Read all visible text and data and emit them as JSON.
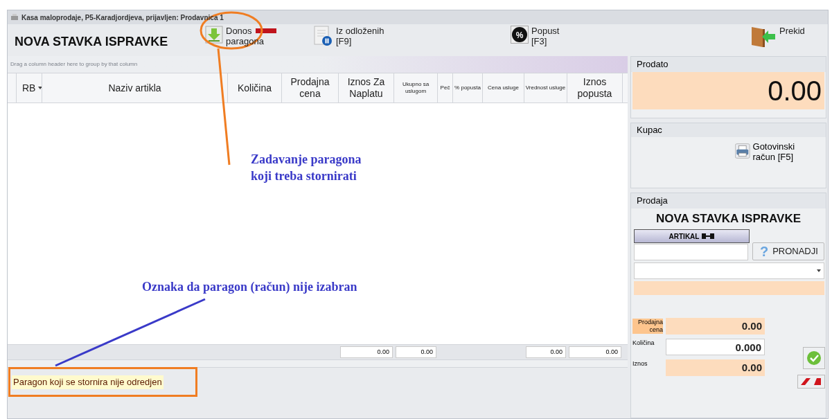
{
  "window": {
    "title": "Kasa maloprodaje, P5-Karadjordjeva, prijavljen: Prodavnica 1"
  },
  "toolbar": {
    "heading": "NOVA STAVKA ISPRAVKE",
    "buttons": [
      {
        "kind": "download",
        "label": "Donos",
        "label2": "paragona"
      },
      {
        "kind": "deferred",
        "label": "Iz odloženih",
        "label2": "[F9]"
      },
      {
        "kind": "discount",
        "label": "Popust",
        "label2": "[F3]",
        "icon_text": "%"
      },
      {
        "kind": "exit",
        "label": "Prekid"
      }
    ]
  },
  "grid": {
    "group_hint": "Drag a column header here to group by that column",
    "columns": [
      {
        "label": "RB",
        "sort": true
      },
      {
        "label": "Naziv artikla",
        "sort": false
      },
      {
        "label": "Količina",
        "sort": false
      },
      {
        "label": "Prodajna cena",
        "sort": false
      },
      {
        "label": "Iznos Za Naplatu",
        "sort": false
      },
      {
        "label": "Ukupno sa uslugom",
        "sort": false
      },
      {
        "label": "Peč",
        "sort": false
      },
      {
        "label": "% popusta",
        "sort": false
      },
      {
        "label": "Cena usluge",
        "sort": false
      },
      {
        "label": "Vrednost usluge",
        "sort": false
      },
      {
        "label": "Iznos popusta",
        "sort": false
      }
    ],
    "totals": [
      "0.00",
      "0.00",
      "0.00",
      "0.00"
    ]
  },
  "status_message": "Paragon koji se stornira nije odredjen",
  "sold": {
    "title": "Prodato",
    "amount": "0.00"
  },
  "customer": {
    "title": "Kupac",
    "button": "Gotovinski račun [F5]"
  },
  "sale": {
    "title": "Prodaja",
    "heading": "NOVA STAVKA ISPRAVKE",
    "article_label": "ARTIKAL",
    "find_button": "PRONADJI",
    "find_icon": "?",
    "fields": [
      {
        "label": "Prodajna cena",
        "value": "0.00",
        "kind": "readonly"
      },
      {
        "label": "Količina",
        "value": "0.000",
        "kind": "editable"
      },
      {
        "label": "Iznos",
        "value": "0.00",
        "kind": "readonly"
      }
    ]
  },
  "annotations": [
    {
      "kind": "note",
      "text": "Zadavanje paragona koji treba stornirati"
    },
    {
      "kind": "note",
      "text": "Oznaka da paragon (račun) nije izabran"
    }
  ]
}
